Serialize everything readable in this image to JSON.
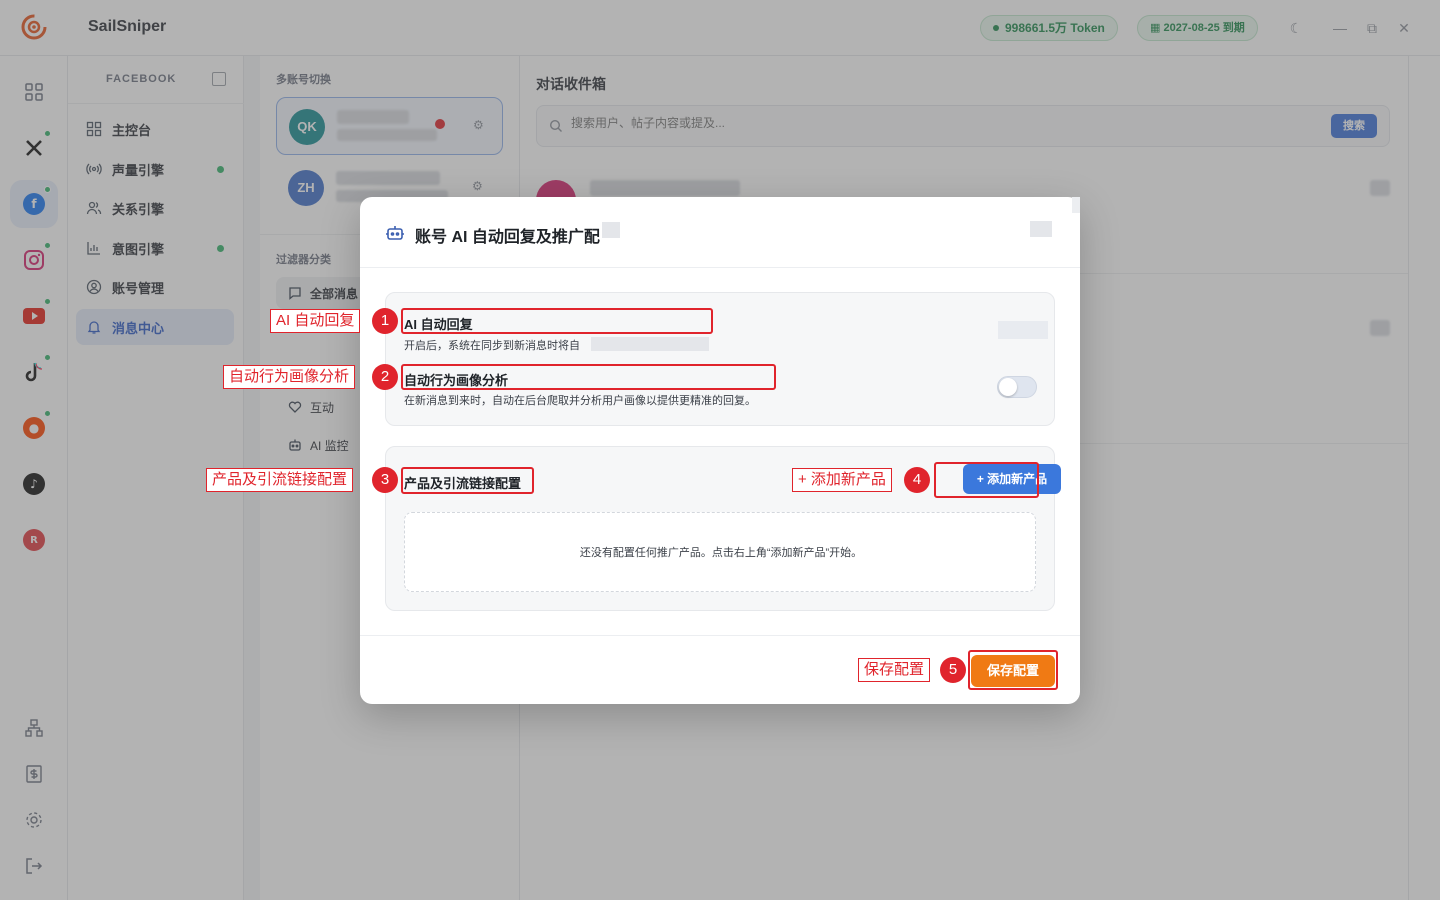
{
  "app": {
    "name": "SailSniper"
  },
  "header": {
    "token_label": "998661.5万 Token",
    "expire_label": "2027-08-25 到期"
  },
  "rail": {
    "items": [
      "dashboard",
      "x",
      "facebook",
      "instagram",
      "youtube",
      "tiktok",
      "reddit",
      "threads",
      "xiaohongshu"
    ],
    "bottom": [
      "org-chart",
      "billing",
      "settings",
      "logout"
    ]
  },
  "subnav": {
    "section": "FACEBOOK",
    "items": [
      {
        "label": "主控台",
        "dot": false
      },
      {
        "label": "声量引擎",
        "dot": true
      },
      {
        "label": "关系引擎",
        "dot": false
      },
      {
        "label": "意图引擎",
        "dot": true
      },
      {
        "label": "账号管理",
        "dot": false
      },
      {
        "label": "消息中心",
        "dot": false,
        "active": true
      }
    ]
  },
  "accounts": {
    "caption": "多账号切换",
    "list": [
      {
        "initials": "QK",
        "color": "#178c93",
        "active": true
      },
      {
        "initials": "ZH",
        "color": "#3f6fc9",
        "active": false
      }
    ],
    "filter_caption": "过滤器分类",
    "filters": [
      {
        "label": "全部消息",
        "active": true
      },
      {
        "label": "互动",
        "active": false
      },
      {
        "label": "AI 监控",
        "active": false
      }
    ]
  },
  "inbox": {
    "title": "对话收件箱",
    "search_placeholder": "搜索用户、帖子内容或提及...",
    "search_button": "搜索"
  },
  "modal": {
    "title": "账号 AI 自动回复及推广配",
    "ai_reply": {
      "label": "AI 自动回复",
      "desc": "开启后，系统在同步到新消息时将自",
      "enabled": false
    },
    "persona": {
      "label": "自动行为画像分析",
      "desc": "在新消息到来时，自动在后台爬取并分析用户画像以提供更精准的回复。",
      "enabled": false
    },
    "products": {
      "label": "产品及引流链接配置",
      "add_button": "+ 添加新产品",
      "empty_text": "还没有配置任何推广产品。点击右上角“添加新产品”开始。"
    },
    "save_button": "保存配置"
  },
  "annotations": [
    {
      "num": "1",
      "label": "AI 自动回复"
    },
    {
      "num": "2",
      "label": "自动行为画像分析"
    },
    {
      "num": "3",
      "label": "产品及引流链接配置"
    },
    {
      "num": "4",
      "label": "+ 添加新产品"
    },
    {
      "num": "5",
      "label": "保存配置"
    }
  ],
  "colors": {
    "accent_blue": "#3b78dc",
    "save_orange": "#f07a14",
    "annotation_red": "#e0242c",
    "status_green": "#1f8a4c"
  }
}
